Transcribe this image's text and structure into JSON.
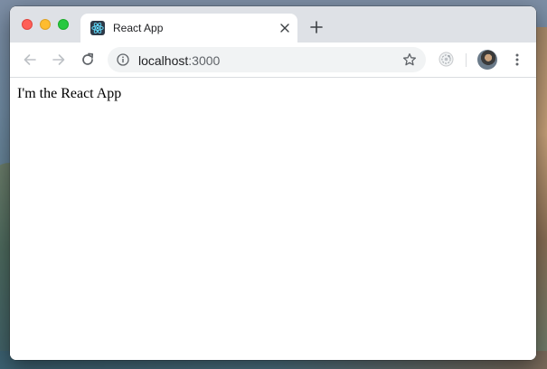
{
  "browser": {
    "tab": {
      "title": "React App",
      "favicon": "react-logo-icon"
    },
    "address_bar": {
      "host": "localhost",
      "port": ":3000"
    },
    "icons": {
      "back": "arrow-left-icon",
      "forward": "arrow-right-icon",
      "reload": "reload-icon",
      "info": "info-icon",
      "bookmark": "star-icon",
      "extension": "extension-icon",
      "profile": "avatar",
      "menu": "kebab-menu-icon",
      "new_tab": "plus-icon",
      "close_tab": "close-icon"
    },
    "colors": {
      "tabstrip": "#dee1e6",
      "omnibox": "#f1f3f4",
      "react": "#61dafb"
    }
  },
  "page": {
    "text": "I'm the React App"
  }
}
